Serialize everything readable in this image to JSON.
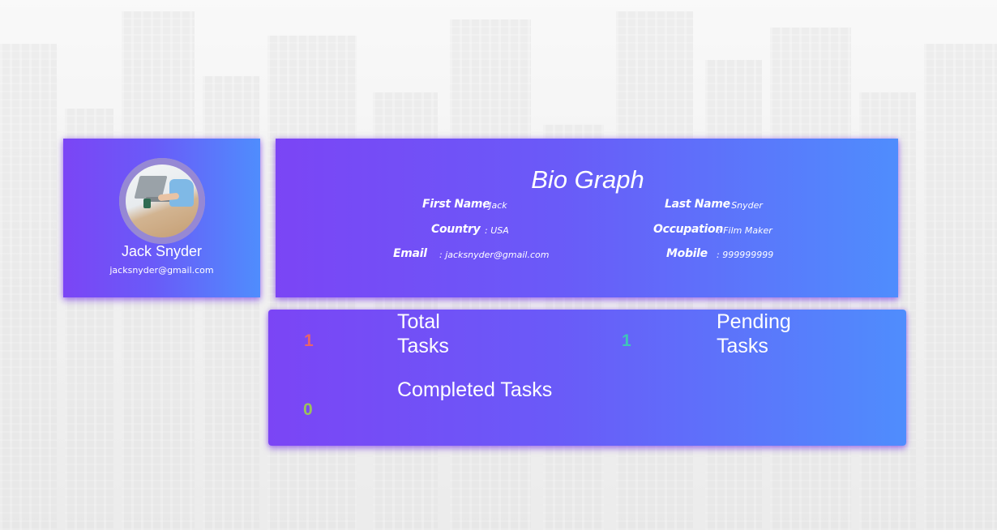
{
  "profile": {
    "name": "Jack Snyder",
    "email": "jacksnyder@gmail.com"
  },
  "bio": {
    "title": "Bio Graph",
    "first_name_label": "First Name",
    "first_name_value": ": Jack",
    "last_name_label": "Last Name",
    "last_name_value": ": Snyder",
    "country_label": "Country",
    "country_value": ": USA",
    "occupation_label": "Occupation",
    "occupation_value": ": Film Maker",
    "email_label": "Email",
    "email_value": ": jacksnyder@gmail.com",
    "mobile_label": "Mobile",
    "mobile_value": ": 999999999"
  },
  "tasks": {
    "total_count": "1",
    "total_label_line1": "Total",
    "total_label_line2": "Tasks",
    "pending_count": "1",
    "pending_label_line1": "Pending",
    "pending_label_line2": "Tasks",
    "completed_count": "0",
    "completed_label": "Completed Tasks"
  },
  "colors": {
    "gradient_start": "#7b45f5",
    "gradient_end": "#4f8dfd",
    "total_count": "#e8646a",
    "pending_count": "#3ec6b8",
    "completed_count": "#9bc25b"
  }
}
